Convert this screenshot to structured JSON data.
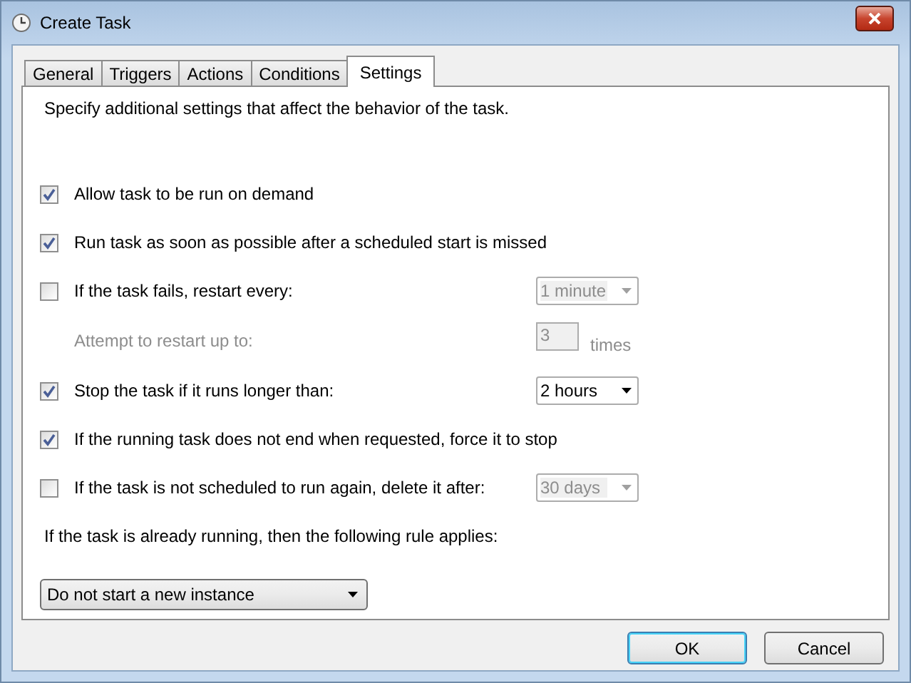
{
  "window": {
    "title": "Create Task"
  },
  "tabs": [
    {
      "label": "General",
      "selected": false
    },
    {
      "label": "Triggers",
      "selected": false
    },
    {
      "label": "Actions",
      "selected": false
    },
    {
      "label": "Conditions",
      "selected": false
    },
    {
      "label": "Settings",
      "selected": true
    }
  ],
  "description": "Specify additional settings that affect the behavior of the task.",
  "settings": [
    {
      "kind": "check",
      "label": "Allow task to be run on demand",
      "checked": true
    },
    {
      "kind": "check",
      "label": "Run task as soon as possible after a scheduled start is missed",
      "checked": true
    },
    {
      "kind": "check",
      "label": "If the task fails, restart every:",
      "checked": false,
      "dropdown": {
        "value": "1 minute",
        "disabled": true
      }
    },
    {
      "kind": "indent",
      "label": "Attempt to restart up to:",
      "disabled": true,
      "number": {
        "value": "3",
        "suffix": "times",
        "disabled": true
      }
    },
    {
      "kind": "check",
      "label": "Stop the task if it runs longer than:",
      "checked": true,
      "dropdown": {
        "value": "2 hours",
        "disabled": false
      }
    },
    {
      "kind": "check",
      "label": "If the running task does not end when requested, force it to stop",
      "checked": true
    },
    {
      "kind": "check",
      "label": "If the task is not scheduled to run again, delete it after:",
      "checked": false,
      "dropdown": {
        "value": "30 days",
        "disabled": true
      }
    }
  ],
  "rule_label": "If the task is already running, then the following rule applies:",
  "rule_dropdown": {
    "value": "Do not start a new instance"
  },
  "buttons": [
    {
      "label": "OK",
      "default": true
    },
    {
      "label": "Cancel",
      "default": false
    }
  ]
}
